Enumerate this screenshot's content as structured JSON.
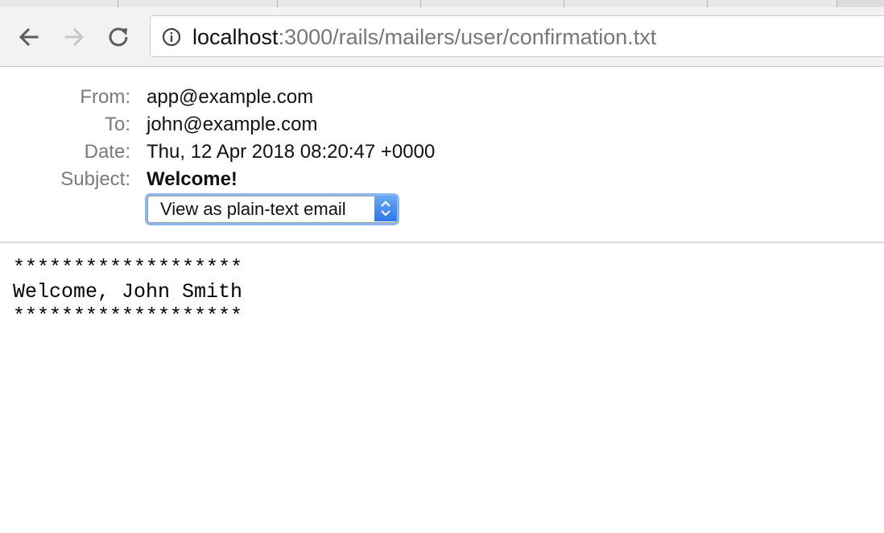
{
  "browser": {
    "url_host": "localhost",
    "url_rest": ":3000/rails/mailers/user/confirmation.txt",
    "back_icon": "arrow-left-icon",
    "forward_icon": "arrow-right-icon",
    "reload_icon": "reload-icon",
    "info_icon": "info-circle-icon"
  },
  "email": {
    "headers": [
      {
        "label": "From:",
        "value": "app@example.com"
      },
      {
        "label": "To:",
        "value": "john@example.com"
      },
      {
        "label": "Date:",
        "value": "Thu, 12 Apr 2018 08:20:47 +0000"
      },
      {
        "label": "Subject:",
        "value": "Welcome!"
      }
    ],
    "format_select": {
      "selected": "View as plain-text email"
    },
    "body_lines": [
      "*******************",
      "Welcome, John Smith",
      "*******************"
    ]
  },
  "colors": {
    "select_accent": "#2e78e8",
    "select_focus_ring": "#8cb6ef"
  }
}
